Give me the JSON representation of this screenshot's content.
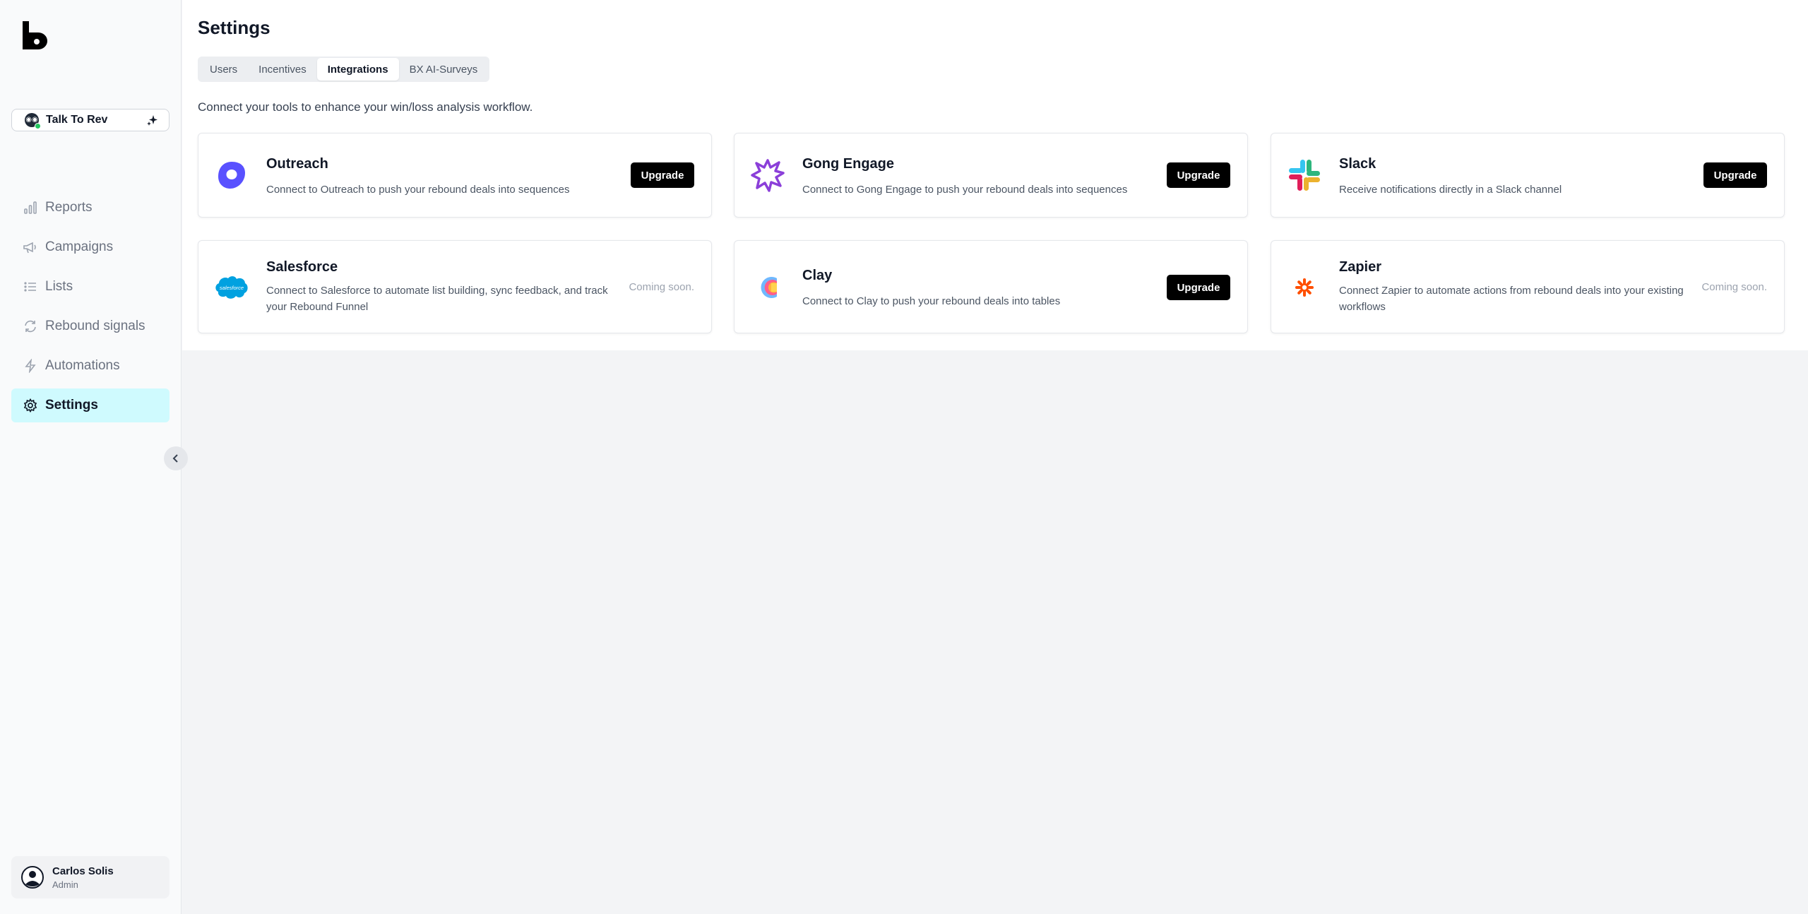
{
  "sidebar": {
    "workspace": {
      "name": "Talk To Rev"
    },
    "nav": [
      {
        "label": "Reports",
        "icon": "bar-chart-icon"
      },
      {
        "label": "Campaigns",
        "icon": "megaphone-icon"
      },
      {
        "label": "Lists",
        "icon": "list-icon"
      },
      {
        "label": "Rebound signals",
        "icon": "refresh-icon"
      },
      {
        "label": "Automations",
        "icon": "bolt-icon"
      },
      {
        "label": "Settings",
        "icon": "gear-icon",
        "active": true
      }
    ],
    "user": {
      "name": "Carlos Solis",
      "role": "Admin"
    }
  },
  "main": {
    "title": "Settings",
    "tabs": [
      {
        "label": "Users"
      },
      {
        "label": "Incentives"
      },
      {
        "label": "Integrations",
        "active": true
      },
      {
        "label": "BX AI-Surveys"
      }
    ],
    "subtitle": "Connect your tools to enhance your win/loss analysis workflow.",
    "integrations": [
      {
        "name": "Outreach",
        "description": "Connect to Outreach to push your rebound deals into sequences",
        "action": "Upgrade",
        "icon": "outreach-logo-icon"
      },
      {
        "name": "Gong Engage",
        "description": "Connect to Gong Engage to push your rebound deals into sequences",
        "action": "Upgrade",
        "icon": "gong-logo-icon"
      },
      {
        "name": "Slack",
        "description": "Receive notifications directly in a Slack channel",
        "action": "Upgrade",
        "icon": "slack-logo-icon"
      },
      {
        "name": "Salesforce",
        "description": "Connect to Salesforce to automate list building, sync feedback, and track your Rebound Funnel",
        "action": "Coming soon.",
        "icon": "salesforce-logo-icon",
        "logo_text": "salesforce"
      },
      {
        "name": "Clay",
        "description": "Connect to Clay to push your rebound deals into tables",
        "action": "Upgrade",
        "icon": "clay-logo-icon"
      },
      {
        "name": "Zapier",
        "description": "Connect Zapier to automate actions from rebound deals into your existing workflows",
        "action": "Coming soon.",
        "icon": "zapier-logo-icon"
      }
    ]
  },
  "colors": {
    "active_nav_bg": "#cffafe",
    "button_bg": "#000000",
    "outreach": "#5951ff",
    "gong": "#8b3fd9",
    "salesforce": "#00a1e0",
    "zapier": "#ff4f00"
  }
}
